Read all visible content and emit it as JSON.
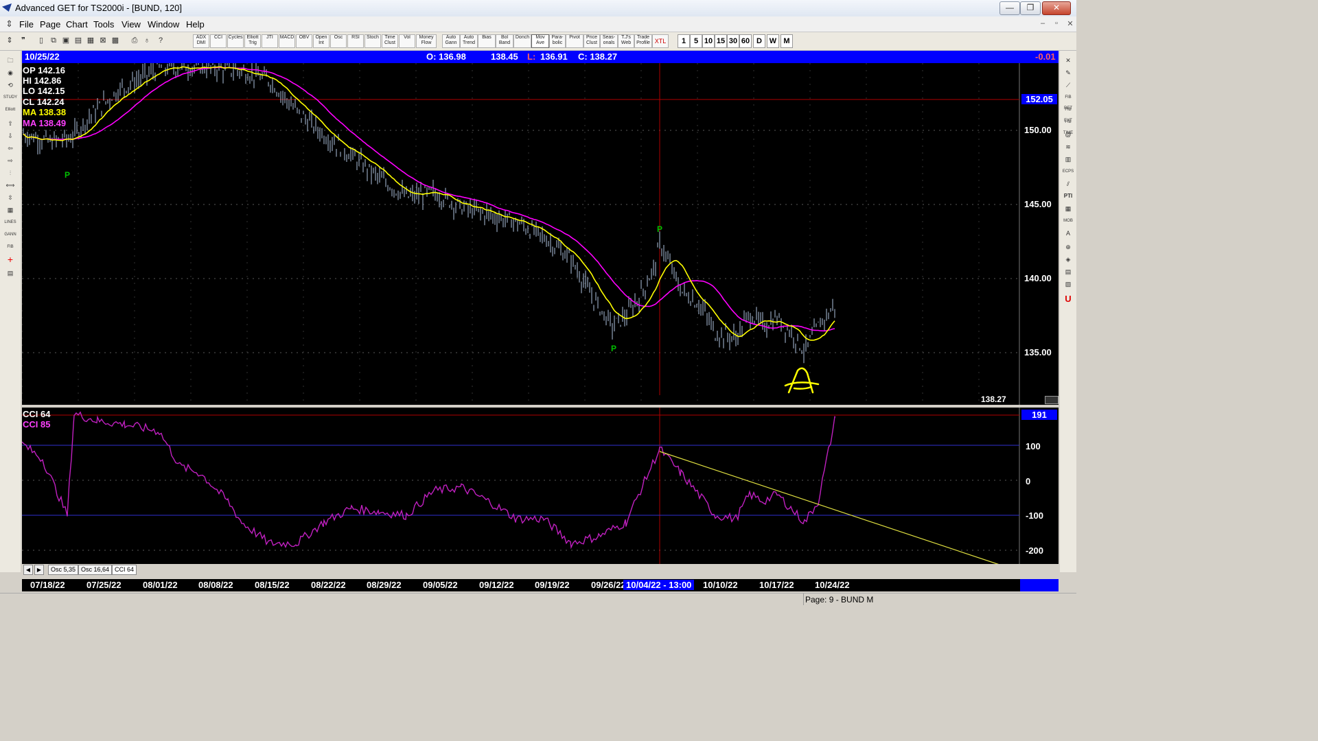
{
  "window": {
    "title": "Advanced GET for TS2000i - [BUND, 120]",
    "min": "—",
    "max": "❐",
    "close": "✕"
  },
  "menu": [
    "File",
    "Page",
    "Chart",
    "Tools",
    "View",
    "Window",
    "Help"
  ],
  "toolbar": {
    "buttons": [
      "ADX DMI",
      "CCI",
      "Cycles",
      "Elliott Trig",
      "JTI",
      "MACD",
      "OBV",
      "Open Int",
      "Osc",
      "RSI",
      "Stoch",
      "Time Clust",
      "Vol",
      "Money Flow",
      "Auto Gann",
      "Auto Trend",
      "Bias",
      "Bol Band",
      "Donch",
      "Mov Ave",
      "Para-bolic",
      "Pivot",
      "Price Clust",
      "Seas-onals",
      "T.J's Web",
      "Trade Profile",
      "XTL"
    ],
    "intervals": [
      "1",
      "5",
      "10",
      "15",
      "30",
      "60",
      "D",
      "W",
      "M"
    ]
  },
  "left_tools": [
    "STUDY",
    "Elliott",
    "LINES",
    "GANN",
    "FIB"
  ],
  "right_tools": [
    "FIB RET",
    "FIB EXT",
    "FIB TIME",
    "ECPS",
    "PTI",
    "MOB"
  ],
  "info_bar": {
    "date": "10/25/22",
    "open": "O: 136.98",
    "high": "138.45",
    "low_label": "L:",
    "low": "136.91",
    "close": "C: 138.27",
    "change": "-0.01"
  },
  "readout": {
    "op": "OP  142.16",
    "hi": "HI   142.86",
    "lo": "LO  142.15",
    "cl": "CL  142.24",
    "ma1": "MA  138.38",
    "ma2": "MA  138.49"
  },
  "price_panel": {
    "cursor_price": "152.05",
    "last_price": "138.27",
    "y_ticks": [
      "150.00",
      "145.00",
      "140.00",
      "135.00"
    ],
    "pivot_label": "P",
    "colors": {
      "ma_fast": "#ffff00",
      "ma_slow": "#ff00ff",
      "bars": "#b0c4e0",
      "pivot": "#00c000"
    }
  },
  "cci_panel": {
    "label1": "CCI 64",
    "label2": "CCI  85",
    "value": "191",
    "y_ticks": [
      "100",
      "0",
      "-100",
      "-200"
    ]
  },
  "tabs": [
    "Osc 5,35",
    "Osc 16,64",
    "CCI 64"
  ],
  "date_axis": [
    "07/18/22",
    "07/25/22",
    "08/01/22",
    "08/08/22",
    "08/15/22",
    "08/22/22",
    "08/29/22",
    "09/05/22",
    "09/12/22",
    "09/19/22",
    "09/26/22",
    "10/04/22 - 13:00",
    "10/10/22",
    "10/17/22",
    "10/24/22"
  ],
  "status": "Page: 9 - BUND M"
}
